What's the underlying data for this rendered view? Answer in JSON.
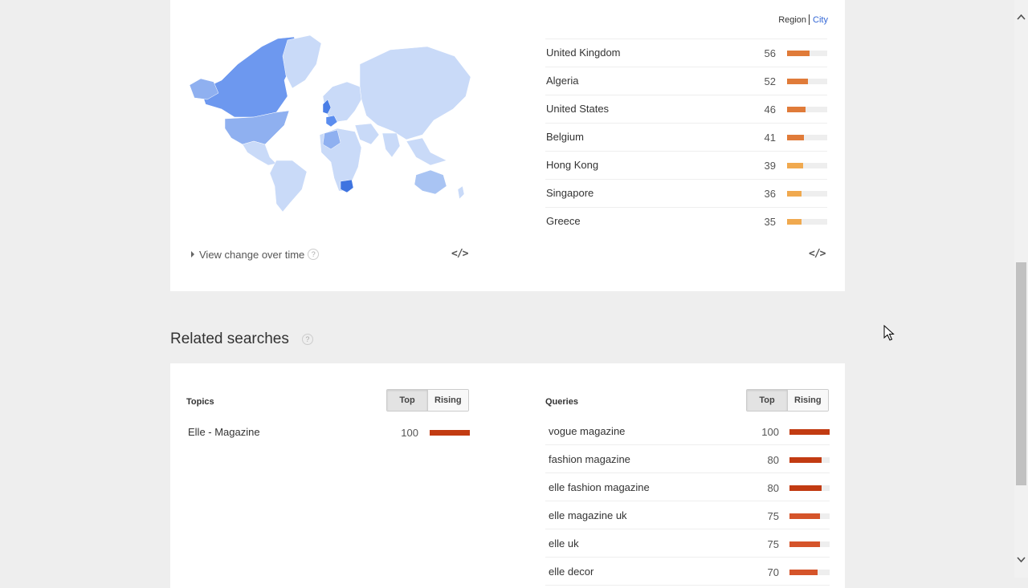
{
  "region_card": {
    "toggle": {
      "region": "Region",
      "city": "City"
    },
    "regions": [
      {
        "name": "United Kingdom",
        "value": "56",
        "pct": 56,
        "color": "#e07b39"
      },
      {
        "name": "Algeria",
        "value": "52",
        "pct": 52,
        "color": "#e07b39"
      },
      {
        "name": "United States",
        "value": "46",
        "pct": 46,
        "color": "#e07b39"
      },
      {
        "name": "Belgium",
        "value": "41",
        "pct": 41,
        "color": "#e07b39"
      },
      {
        "name": "Hong Kong",
        "value": "39",
        "pct": 39,
        "color": "#f0a94f"
      },
      {
        "name": "Singapore",
        "value": "36",
        "pct": 36,
        "color": "#f0a94f"
      },
      {
        "name": "Greece",
        "value": "35",
        "pct": 35,
        "color": "#f0a94f"
      }
    ],
    "view_change_label": "View change over time",
    "help_glyph": "?",
    "embed_glyph": "</>"
  },
  "related": {
    "title": "Related searches",
    "help_glyph": "?",
    "topics": {
      "label": "Topics",
      "top_label": "Top",
      "rising_label": "Rising",
      "rows": [
        {
          "name": "Elle - Magazine",
          "value": "100",
          "pct": 100,
          "color": "#c23b12"
        }
      ]
    },
    "queries": {
      "label": "Queries",
      "top_label": "Top",
      "rising_label": "Rising",
      "rows": [
        {
          "name": "vogue magazine",
          "value": "100",
          "pct": 100,
          "color": "#c23b12"
        },
        {
          "name": "fashion magazine",
          "value": "80",
          "pct": 80,
          "color": "#c23b12"
        },
        {
          "name": "elle fashion magazine",
          "value": "80",
          "pct": 80,
          "color": "#c23b12"
        },
        {
          "name": "elle magazine uk",
          "value": "75",
          "pct": 75,
          "color": "#d5542a"
        },
        {
          "name": "elle uk",
          "value": "75",
          "pct": 75,
          "color": "#d5542a"
        },
        {
          "name": "elle decor",
          "value": "70",
          "pct": 70,
          "color": "#d5542a"
        }
      ]
    }
  },
  "colors": {
    "map_highlight": "#5b8def",
    "map_mid": "#8fb0f0",
    "map_light": "#c9daf8",
    "link_blue": "#3367d6"
  },
  "icons": {
    "scroll_up": "chevron-up-icon",
    "scroll_down": "chevron-down-icon",
    "cursor": "mouse-pointer-icon"
  }
}
